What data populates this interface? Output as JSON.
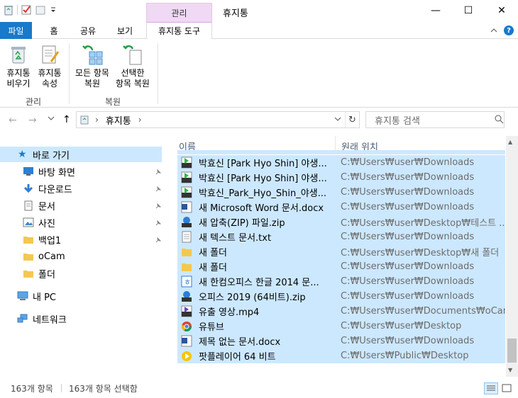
{
  "window": {
    "title": "휴지통",
    "context_tab_label": "관리",
    "minimize_glyph": "—",
    "maximize_glyph": "☐",
    "close_glyph": "✕"
  },
  "tabs": {
    "file": "파일",
    "home": "홈",
    "share": "공유",
    "view": "보기",
    "recycle_tools": "휴지통 도구"
  },
  "ribbon": {
    "empty_line1": "휴지통",
    "empty_line2": "비우기",
    "props_line1": "휴지통",
    "props_line2": "속성",
    "group_manage": "관리",
    "restore_all_line1": "모든 항목",
    "restore_all_line2": "복원",
    "restore_sel_line1": "선택한",
    "restore_sel_line2": "항목 복원",
    "group_restore": "복원"
  },
  "address": {
    "current": "휴지통",
    "search_placeholder": "휴지통 검색"
  },
  "nav": {
    "quick_access": "바로 가기",
    "items": [
      {
        "label": "바탕 화면",
        "icon": "desktop-icon",
        "pinned": true
      },
      {
        "label": "다운로드",
        "icon": "download-icon",
        "pinned": true
      },
      {
        "label": "문서",
        "icon": "document-icon",
        "pinned": true
      },
      {
        "label": "사진",
        "icon": "pictures-icon",
        "pinned": true
      },
      {
        "label": "백업1",
        "icon": "folder-icon",
        "pinned": true
      },
      {
        "label": "oCam",
        "icon": "folder-icon",
        "pinned": false
      },
      {
        "label": "폴더",
        "icon": "folder-icon",
        "pinned": false
      }
    ],
    "this_pc": "내 PC",
    "network": "네트워크"
  },
  "columns": {
    "name": "이름",
    "location": "원래 위치"
  },
  "files": [
    {
      "name": "박효신 [Park Hyo Shin] 야생...",
      "location": "C:₩Users₩user₩Downloads",
      "icon": "mp3-icon"
    },
    {
      "name": "박효신 [Park Hyo Shin] 야생...",
      "location": "C:₩Users₩user₩Downloads",
      "icon": "mp3-icon"
    },
    {
      "name": "박효신_Park_Hyo_Shin_야생...",
      "location": "C:₩Users₩user₩Downloads",
      "icon": "mp3-icon"
    },
    {
      "name": "새 Microsoft Word 문서.docx",
      "location": "C:₩Users₩user₩Downloads",
      "icon": "word-icon"
    },
    {
      "name": "새 압축(ZIP) 파일.zip",
      "location": "C:₩Users₩user₩Desktop₩테스트 ...",
      "icon": "zip-icon"
    },
    {
      "name": "새 텍스트 문서.txt",
      "location": "C:₩Users₩user₩Downloads",
      "icon": "text-file-icon"
    },
    {
      "name": "새 폴더",
      "location": "C:₩Users₩user₩Desktop₩새 폴더",
      "icon": "folder-icon"
    },
    {
      "name": "새 폴더",
      "location": "C:₩Users₩user₩Downloads",
      "icon": "folder-icon"
    },
    {
      "name": "새 한컴오피스 한글 2014 문...",
      "location": "C:₩Users₩user₩Downloads",
      "icon": "hwp-icon"
    },
    {
      "name": "오피스 2019 (64비트).zip",
      "location": "C:₩Users₩user₩Downloads",
      "icon": "zip-icon"
    },
    {
      "name": "유출 영상.mp4",
      "location": "C:₩Users₩user₩Documents₩oCam",
      "icon": "mp4-icon"
    },
    {
      "name": "유튜브",
      "location": "C:₩Users₩user₩Desktop",
      "icon": "chrome-icon"
    },
    {
      "name": "제목 없는 문서.docx",
      "location": "C:₩Users₩user₩Downloads",
      "icon": "word-icon"
    },
    {
      "name": "팟플레이어 64 비트",
      "location": "C:₩Users₩Public₩Desktop",
      "icon": "potplayer-icon"
    }
  ],
  "status": {
    "count": "163개 항목",
    "selected": "163개 항목 선택함"
  },
  "colors": {
    "accent": "#1979ca",
    "selection": "#cce8ff",
    "context_tab": "#f0d9f4"
  }
}
